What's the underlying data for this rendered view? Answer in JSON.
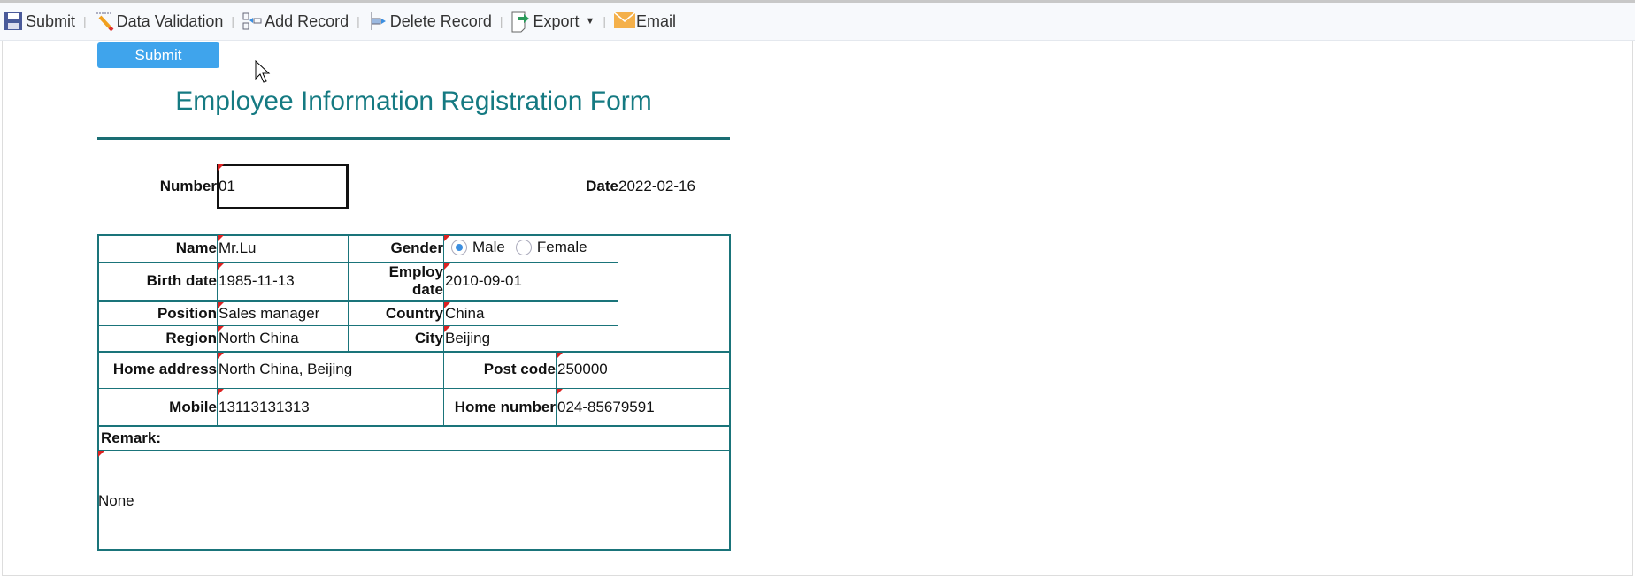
{
  "toolbar": {
    "submit": "Submit",
    "validation": "Data Validation",
    "add": "Add Record",
    "delete": "Delete Record",
    "export": "Export",
    "email": "Email"
  },
  "submit_button": "Submit",
  "title": "Employee Information Registration Form",
  "header": {
    "number_label": "Number",
    "number_value": "01",
    "date_label": "Date",
    "date_value": "2022-02-16"
  },
  "fields": {
    "name_label": "Name",
    "name": "Mr.Lu",
    "gender_label": "Gender",
    "gender_options": [
      "Male",
      "Female"
    ],
    "gender_selected": "Male",
    "birth_label": "Birth date",
    "birth": "1985-11-13",
    "employ_label_1": "Employ",
    "employ_label_2": "date",
    "employ": "2010-09-01",
    "position_label": "Position",
    "position": "Sales manager",
    "country_label": "Country",
    "country": "China",
    "region_label": "Region",
    "region": "North China",
    "city_label": "City",
    "city": "Beijing",
    "address_label": "Home address",
    "address": "North China, Beijing",
    "post_label": "Post code",
    "post": "250000",
    "mobile_label": "Mobile",
    "mobile": "13113131313",
    "home_label": "Home number",
    "home": "024-85679591",
    "remark_label": "Remark:",
    "remark": "None"
  },
  "colors": {
    "accent": "#157a82",
    "button": "#3fa4ec"
  }
}
